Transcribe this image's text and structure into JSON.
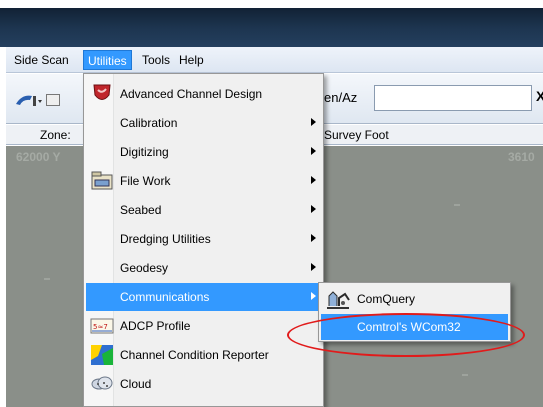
{
  "menubar": {
    "items": [
      {
        "label": "Side Scan"
      },
      {
        "label": "Utilities",
        "active": true
      },
      {
        "label": "Tools"
      },
      {
        "label": "Help"
      }
    ]
  },
  "toolbar": {
    "en_label": "en/Az",
    "close_glyph": "X"
  },
  "status": {
    "zone_label": "Zone:",
    "units_label": "Survey Foot"
  },
  "map": {
    "coord_left": "62000 Y",
    "coord_right": "3610"
  },
  "utilities_menu": {
    "items": [
      {
        "label": "Advanced Channel Design",
        "icon": "channel-design-icon",
        "submenu": false
      },
      {
        "label": "Calibration",
        "submenu": true
      },
      {
        "label": "Digitizing",
        "submenu": true
      },
      {
        "label": "File Work",
        "icon": "file-work-icon",
        "submenu": true
      },
      {
        "label": "Seabed",
        "submenu": true
      },
      {
        "label": "Dredging Utilities",
        "submenu": true
      },
      {
        "label": "Geodesy",
        "submenu": true
      },
      {
        "label": "Communications",
        "submenu": true,
        "highlighted": true
      },
      {
        "label": "ADCP Profile",
        "icon": "adcp-profile-icon",
        "submenu": false
      },
      {
        "label": "Channel Condition Reporter",
        "icon": "channel-condition-icon",
        "submenu": false
      },
      {
        "label": "Cloud",
        "icon": "cloud-icon",
        "submenu": false
      }
    ]
  },
  "communications_submenu": {
    "items": [
      {
        "label": "ComQuery",
        "icon": "comquery-icon"
      },
      {
        "label": "Comtrol's WCom32",
        "highlighted": true
      }
    ]
  },
  "colors": {
    "highlight": "#3399ff",
    "annotation_circle": "#e11b1b",
    "map_bg": "#8a8f89"
  }
}
